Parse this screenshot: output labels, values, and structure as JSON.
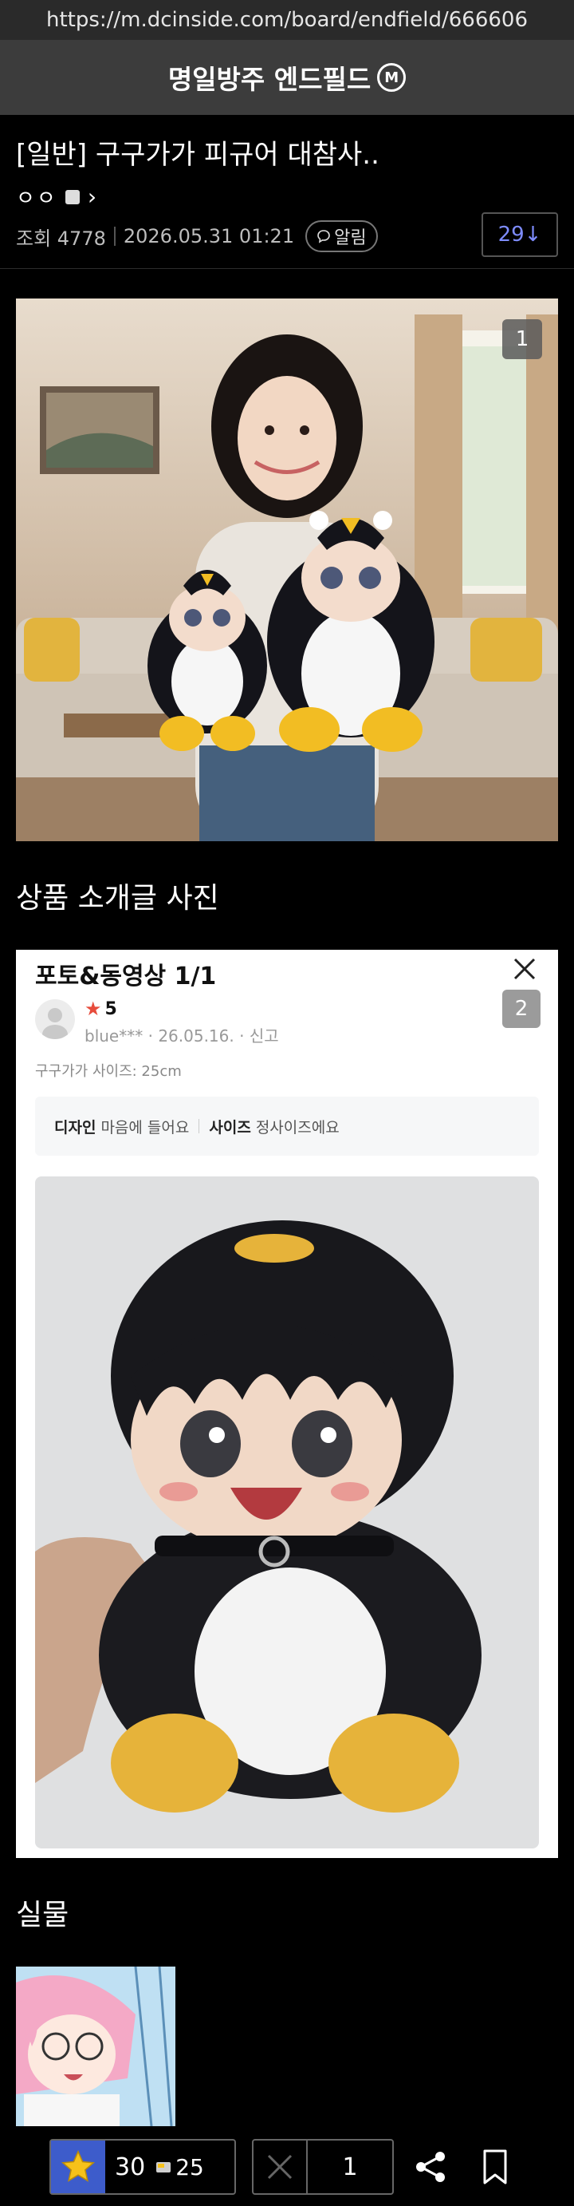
{
  "browser": {
    "url": "https://m.dcinside.com/board/endfield/666606"
  },
  "gallery": {
    "name": "명일방주 엔드필드",
    "badge": "M"
  },
  "post": {
    "title": "[일반] 구구가가 피규어 대참사..",
    "author_glyphs": "ㅇㅇ",
    "views": "조회 4778",
    "datetime": "2026.05.31 01:21",
    "alarm_label": "알림",
    "comment_count": "29↓"
  },
  "images": [
    {
      "badge": "1",
      "description_icon": "woman-holding-penguin-plush-photo"
    },
    {
      "badge": "2",
      "description_icon": "product-review-screenshot"
    }
  ],
  "sections": {
    "intro": "상품 소개글 사진",
    "real": "실물"
  },
  "review": {
    "title": "포토&동영상 1/1",
    "rating": "5",
    "user": "blue***",
    "date": "26.05.16.",
    "report": "신고",
    "size_label": "구구가가 사이즈: 25cm",
    "tag1_key": "디자인",
    "tag1_value": "마음에 들어요",
    "tag2_key": "사이즈",
    "tag2_value": "정사이즈에요"
  },
  "bottom_bar": {
    "upvotes": "30",
    "fixed_upvotes": "25",
    "downvotes": "1"
  },
  "colors": {
    "accent_blue": "#3d5ccb",
    "comment_blue": "#7e8cff",
    "star_yellow": "#f6c21a",
    "rating_red": "#e74c3c"
  }
}
